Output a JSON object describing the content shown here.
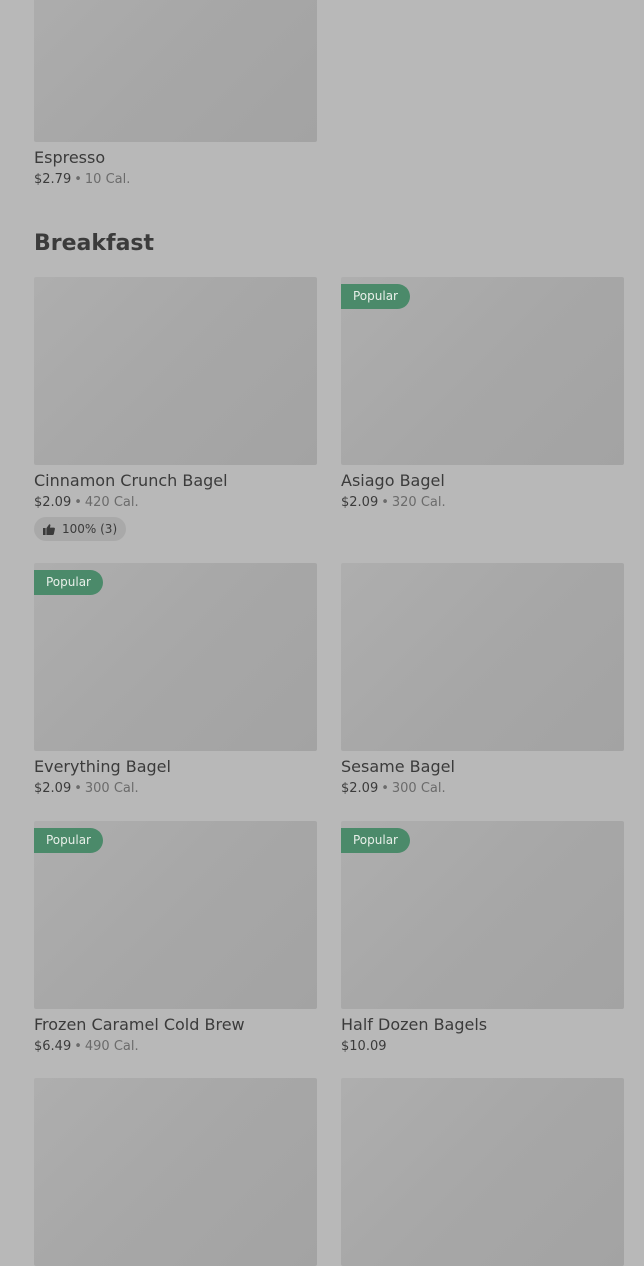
{
  "section": {
    "title": "Breakfast"
  },
  "items": [
    {
      "name": "Espresso",
      "price": "$2.79",
      "calories": "10 Cal.",
      "badge": ""
    },
    {
      "name": "Cinnamon Crunch Bagel",
      "price": "$2.09",
      "calories": "420 Cal.",
      "badge": "",
      "rating": "100% (3)"
    },
    {
      "name": "Asiago Bagel",
      "price": "$2.09",
      "calories": "320 Cal.",
      "badge": "Popular"
    },
    {
      "name": "Everything Bagel",
      "price": "$2.09",
      "calories": "300 Cal.",
      "badge": "Popular"
    },
    {
      "name": "Sesame Bagel",
      "price": "$2.09",
      "calories": "300 Cal.",
      "badge": ""
    },
    {
      "name": "Frozen Caramel Cold Brew",
      "price": "$6.49",
      "calories": "490 Cal.",
      "badge": "Popular"
    },
    {
      "name": "Half Dozen Bagels",
      "price": "$10.09",
      "calories": "",
      "badge": "Popular"
    }
  ],
  "separator": "•",
  "icons": {
    "thumbs_up": "thumbs-up-icon"
  },
  "colors": {
    "background": "#b8b8b8",
    "image_placeholder": "#a9a9a9",
    "badge_bg": "#4b8a6a",
    "badge_text": "#e8efe9",
    "text_primary": "#3b3b3b",
    "text_secondary": "#6b6b6b"
  }
}
